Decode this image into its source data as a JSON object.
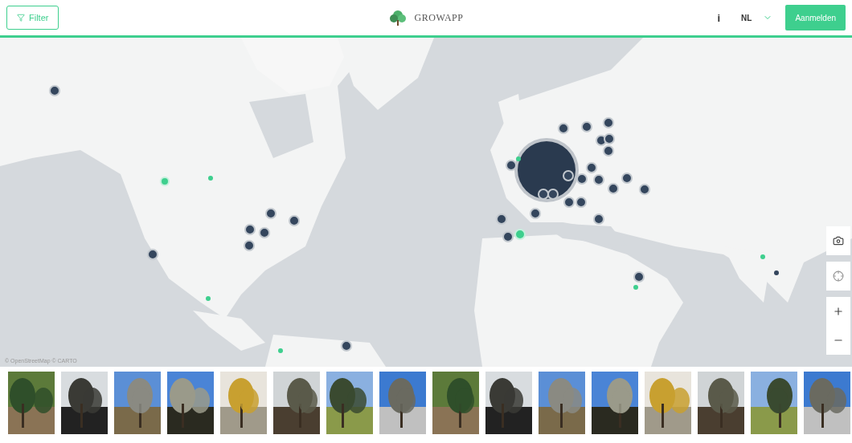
{
  "header": {
    "filter_button": "Filter",
    "brand": "GROWAPP",
    "info": "i",
    "language": "NL",
    "login_button": "Aanmelden"
  },
  "map": {
    "kind": "picture",
    "attribution": "© OpenStreetMap © CARTO",
    "markers": [
      {
        "color": "#34465d"
      },
      {
        "color": "#3ecf8e"
      },
      {
        "color": "#3ecf8e"
      },
      {
        "color": "#34465d"
      },
      {
        "color": "#34465d"
      },
      {
        "color": "#34465d"
      },
      {
        "color": "#34465d"
      },
      {
        "color": "#34465d"
      },
      {
        "color": "#34465d"
      },
      {
        "color": "#3ecf8e"
      },
      {
        "color": "#34465d"
      },
      {
        "color": "#3ecf8e"
      },
      {
        "color": "#2a3a4f"
      },
      {
        "color": "#34465d"
      },
      {
        "color": "#3ecf8e"
      },
      {
        "color": "#34465d"
      },
      {
        "color": "#34465d"
      },
      {
        "color": "#34465d"
      },
      {
        "color": "#34465d"
      },
      {
        "color": "#34465d"
      },
      {
        "color": "#34465d"
      },
      {
        "color": "#34465d"
      },
      {
        "color": "#34465d"
      },
      {
        "color": "#34465d"
      },
      {
        "color": "#34465d"
      },
      {
        "color": "#34465d"
      },
      {
        "color": "#34465d"
      },
      {
        "color": "#34465d"
      },
      {
        "color": "#34465d"
      },
      {
        "color": "#34465d"
      },
      {
        "color": "#34465d"
      },
      {
        "color": "#34465d"
      },
      {
        "color": "#34465d"
      },
      {
        "color": "#34465d"
      },
      {
        "color": "#34465d"
      },
      {
        "color": "#34465d"
      },
      {
        "color": "#3ecf8e"
      },
      {
        "color": "#3ecf8e"
      },
      {
        "color": "#3ecf8e"
      },
      {
        "color": "#34465d"
      },
      {
        "color": "#34465d"
      }
    ]
  }
}
